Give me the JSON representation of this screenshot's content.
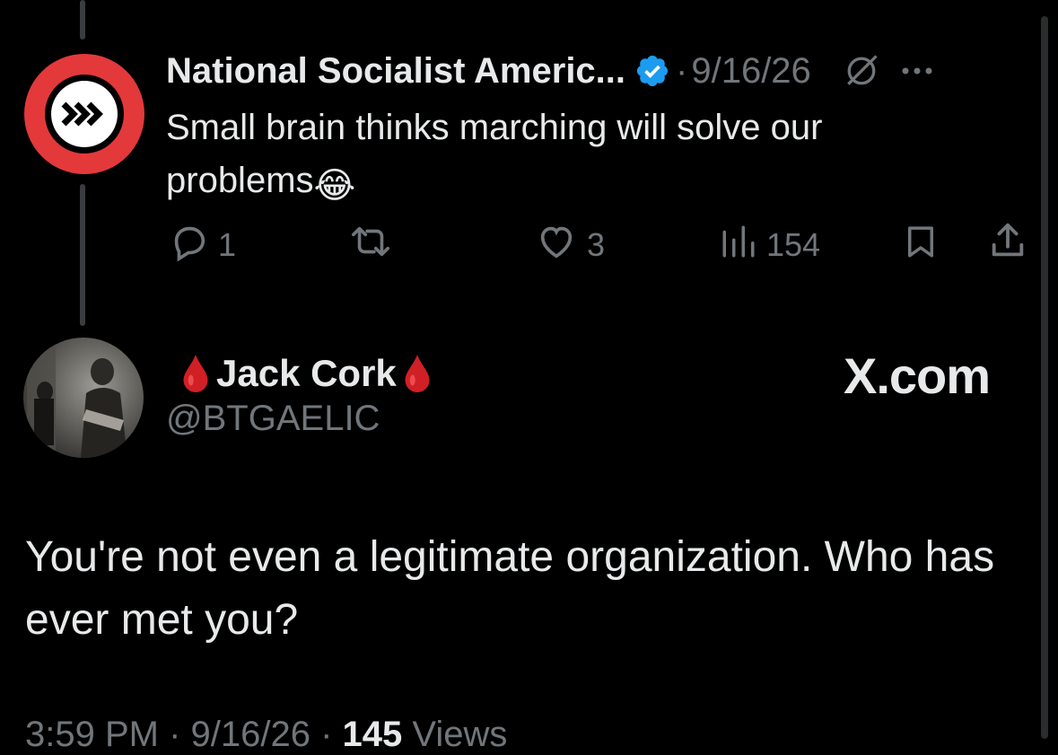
{
  "tweet": {
    "author_name": "National Socialist Americ...",
    "date": "9/16/26",
    "dot": "·",
    "text": "Small brain thinks marching will solve our problems",
    "text_emoji": "😂",
    "actions": {
      "replies": "1",
      "likes": "3",
      "views": "154"
    },
    "icons": [
      "verified-badge-icon",
      "grok-icon",
      "more-icon",
      "reply-icon",
      "retweet-icon",
      "like-icon",
      "views-icon",
      "bookmark-icon",
      "share-icon",
      "chevrons-logo-icon"
    ]
  },
  "reply": {
    "name": "Jack Cork",
    "name_emoji": "🩸",
    "handle": "@BTGAELIC",
    "brand": "X.com",
    "text": "You're not even a legitimate organization. Who has ever met you?",
    "time": "3:59 PM · 9/16/26 · ",
    "views_count": "145",
    "views_label": " Views"
  },
  "colors": {
    "background": "#000000",
    "text": "#e7e9ea",
    "muted": "#71767b",
    "logo_red": "#e3393b",
    "verified_blue": "#1d9bf0",
    "blood_red": "#d11f26"
  }
}
